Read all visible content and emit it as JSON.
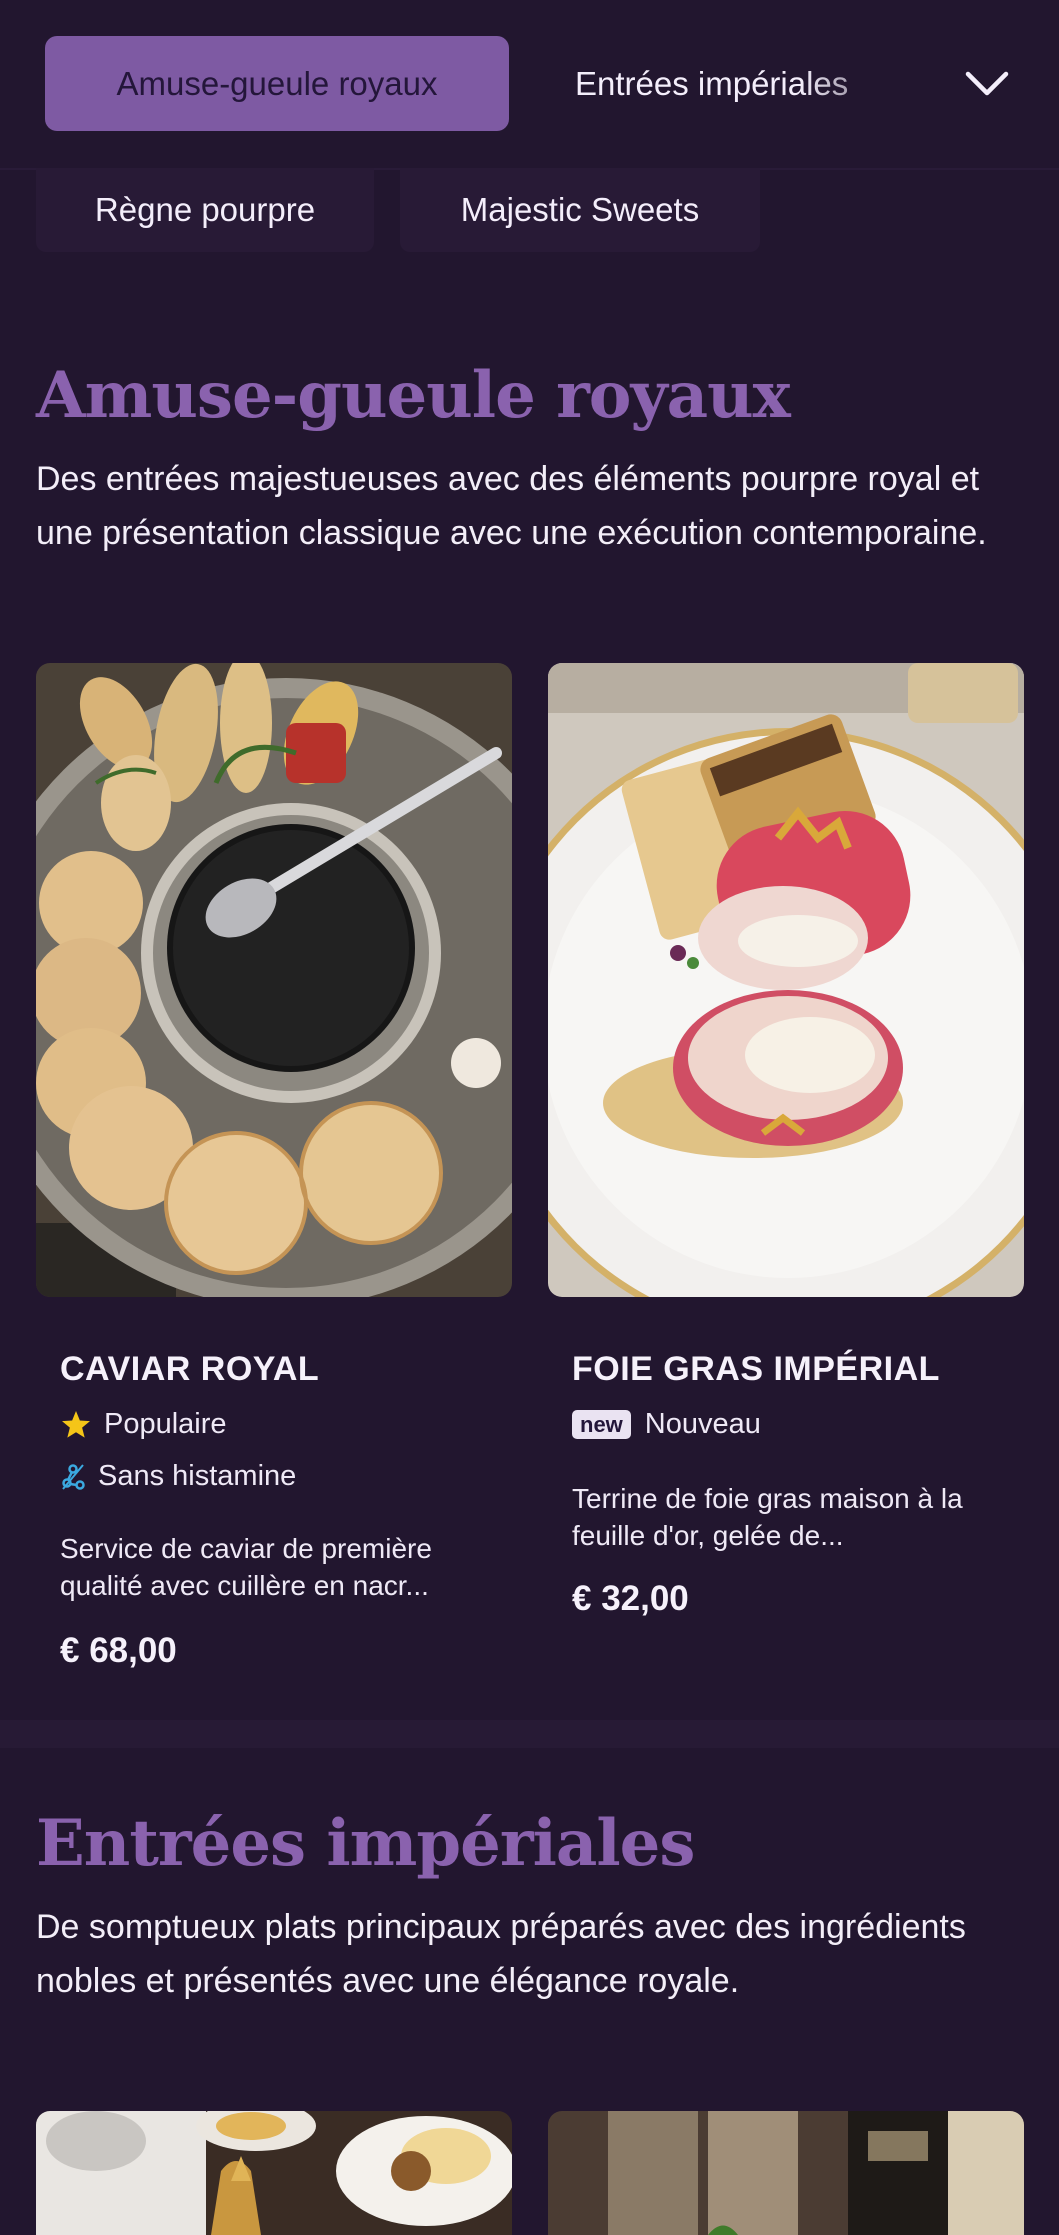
{
  "nav": {
    "active_tab": "Amuse-gueule royaux",
    "next_tab": "Entrées impériales",
    "chips": [
      "Règne pourpre",
      "Majestic Sweets"
    ]
  },
  "sections": [
    {
      "title": "Amuse-gueule royaux",
      "description": "Des entrées majestueuses avec des éléments pourpre royal et une présentation classique avec une exécution contemporaine.",
      "items": [
        {
          "name": "CAVIAR ROYAL",
          "tags": [
            {
              "icon": "star-icon",
              "label": "Populaire"
            },
            {
              "icon": "histamine-free-icon",
              "label": "Sans histamine"
            }
          ],
          "description": "Service de caviar de première qualité avec cuillère en nacr...",
          "price": "€ 68,00"
        },
        {
          "name": "FOIE GRAS IMPÉRIAL",
          "tags": [
            {
              "icon": "new-badge",
              "badge": "new",
              "label": "Nouveau"
            }
          ],
          "description": "Terrine de foie gras maison à la feuille d'or, gelée de...",
          "price": "€ 32,00"
        }
      ]
    },
    {
      "title": "Entrées impériales",
      "description": "De somptueux plats principaux préparés avec des ingrédients nobles et présentés avec une élégance royale."
    }
  ],
  "colors": {
    "background": "#22162f",
    "accent": "#7e5aa3",
    "title": "#8a62ae",
    "star": "#f5c518",
    "histamine_icon": "#3ba9e0"
  }
}
